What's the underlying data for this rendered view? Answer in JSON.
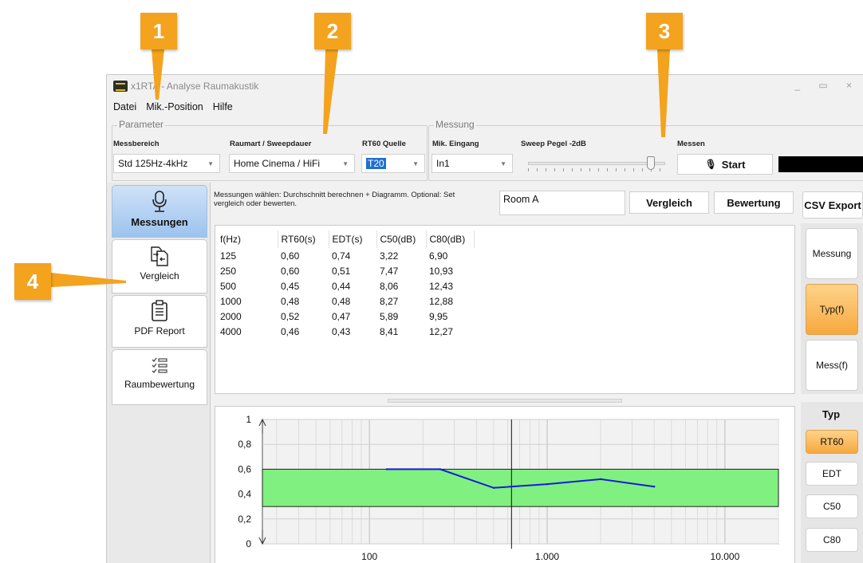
{
  "callouts": [
    "1",
    "2",
    "3",
    "4"
  ],
  "window": {
    "title": "x1RTA - Analyse Raumakustik",
    "controls": "_ ▭ ×"
  },
  "menu": [
    "Datei",
    "Mik.-Position",
    "Hilfe"
  ],
  "parameter": {
    "group_title": "Parameter",
    "messbereich_label": "Messbereich",
    "messbereich_value": "Std 125Hz-4kHz",
    "raumart_label": "Raumart / Sweepdauer",
    "raumart_value": "Home Cinema / HiFi",
    "rt60_label": "RT60 Quelle",
    "rt60_value": "T20"
  },
  "messung": {
    "group_title": "Messung",
    "eingang_label": "Mik. Eingang",
    "eingang_value": "In1",
    "pegel_label": "Sweep Pegel -2dB",
    "pegel_level": 0.92,
    "messen_label": "Messen",
    "start_label": "Start"
  },
  "sidebar": {
    "items": [
      {
        "label": "Messungen",
        "icon": "microphone-icon"
      },
      {
        "label": "Vergleich",
        "icon": "compare-document-icon"
      },
      {
        "label": "PDF Report",
        "icon": "clipboard-icon"
      },
      {
        "label": "Raumbewertung",
        "icon": "checklist-icon"
      }
    ]
  },
  "toolbar": {
    "info_text": "Messungen wählen: Durchschnitt berechnen + Diagramm.  Optional: Set vergleich oder bewerten.",
    "name_value": "Room A",
    "vergleich_label": "Vergleich",
    "bewertung_label": "Bewertung",
    "csv_label": "CSV Export"
  },
  "table": {
    "headers": [
      "f(Hz)",
      "RT60(s)",
      "EDT(s)",
      "C50(dB)",
      "C80(dB)"
    ],
    "rows": [
      [
        "125",
        "0,60",
        "0,74",
        "3,22",
        "6,90"
      ],
      [
        "250",
        "0,60",
        "0,51",
        "7,47",
        "10,93"
      ],
      [
        "500",
        "0,45",
        "0,44",
        "8,06",
        "12,43"
      ],
      [
        "1000",
        "0,48",
        "0,48",
        "8,27",
        "12,88"
      ],
      [
        "2000",
        "0,52",
        "0,47",
        "5,89",
        "9,95"
      ],
      [
        "4000",
        "0,46",
        "0,43",
        "8,41",
        "12,27"
      ]
    ]
  },
  "right_panel": {
    "mode_buttons": [
      "Messung",
      "Typ(f)",
      "Mess(f)"
    ],
    "typ_label": "Typ",
    "typ_buttons": [
      "RT60",
      "EDT",
      "C50",
      "C80"
    ]
  },
  "colors": {
    "accent_orange": "#f3a31e",
    "band_green": "#80f080",
    "line_blue": "#1a1ad8",
    "active_blue": "#9cc3ee"
  },
  "chart_data": {
    "type": "line",
    "x_scale": "log",
    "xlim": [
      25,
      20000
    ],
    "ylim": [
      0,
      1
    ],
    "y_ticks": [
      "0",
      "0,2",
      "0,4",
      "0,6",
      "0,8",
      "1"
    ],
    "x_ticks": [
      "100",
      "1.000",
      "10.000"
    ],
    "band": [
      0.3,
      0.6
    ],
    "cursor_x": 630,
    "series": [
      {
        "x": [
          125,
          250,
          500,
          1000,
          2000,
          4000
        ],
        "y": [
          0.6,
          0.6,
          0.45,
          0.48,
          0.52,
          0.46
        ]
      }
    ],
    "grid": true
  }
}
